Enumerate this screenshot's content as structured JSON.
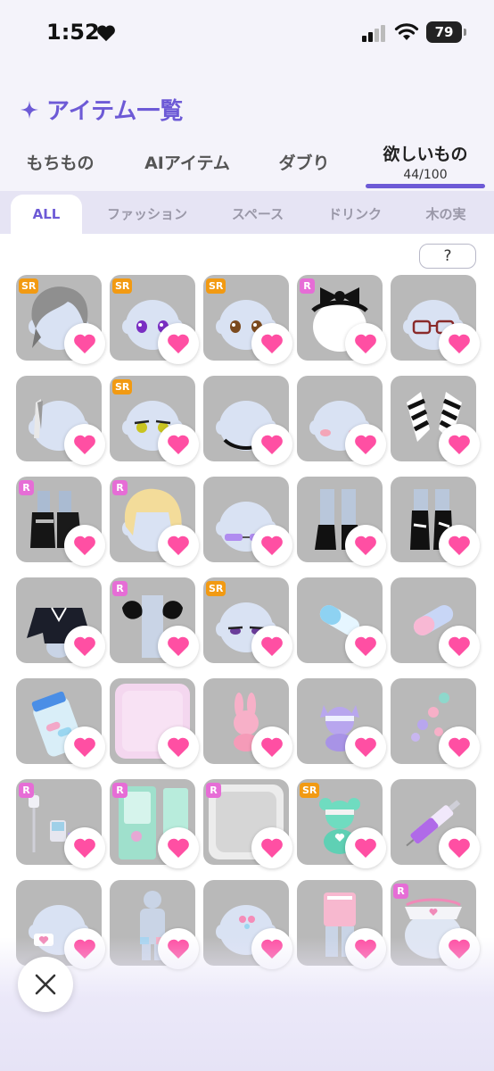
{
  "status": {
    "time": "1:52",
    "battery": "79"
  },
  "header": {
    "title": "アイテム一覧"
  },
  "main_tabs": [
    {
      "label": "もちもの"
    },
    {
      "label": "AIアイテム"
    },
    {
      "label": "ダブり"
    },
    {
      "label": "欲しいもの",
      "count": "44/100",
      "active": true
    }
  ],
  "sub_tabs": [
    {
      "label": "ALL",
      "active": true
    },
    {
      "label": "ファッション"
    },
    {
      "label": "スペース"
    },
    {
      "label": "ドリンク"
    },
    {
      "label": "木の実"
    }
  ],
  "help_label": "?",
  "colors": {
    "accent": "#6d5ad6",
    "heart": "#ff4fa3",
    "sr_badge": "#f29a12",
    "r_badge": "#e66dd6"
  },
  "items": [
    {
      "badge": "SR",
      "art": "hair-silver"
    },
    {
      "badge": "SR",
      "art": "eyes-purple"
    },
    {
      "badge": "SR",
      "art": "eyes-brown"
    },
    {
      "badge": "R",
      "art": "black-ribbon"
    },
    {
      "badge": "",
      "art": "glasses"
    },
    {
      "badge": "",
      "art": "hair-clip"
    },
    {
      "badge": "SR",
      "art": "eyes-green"
    },
    {
      "badge": "",
      "art": "choker"
    },
    {
      "badge": "",
      "art": "blush"
    },
    {
      "badge": "",
      "art": "striped-sleeves"
    },
    {
      "badge": "R",
      "art": "black-boots"
    },
    {
      "badge": "R",
      "art": "blonde-hair"
    },
    {
      "badge": "",
      "art": "sunglasses"
    },
    {
      "badge": "",
      "art": "black-leg-socks"
    },
    {
      "badge": "",
      "art": "ripped-socks"
    },
    {
      "badge": "",
      "art": "black-jacket"
    },
    {
      "badge": "R",
      "art": "puff-sleeves"
    },
    {
      "badge": "SR",
      "art": "eyes-lashes"
    },
    {
      "badge": "",
      "art": "pill-blue"
    },
    {
      "badge": "",
      "art": "pill-pink"
    },
    {
      "badge": "",
      "art": "pill-jar"
    },
    {
      "badge": "",
      "art": "pink-floor"
    },
    {
      "badge": "",
      "art": "bunny-plush"
    },
    {
      "badge": "",
      "art": "cat-plush"
    },
    {
      "badge": "",
      "art": "mini-plushes"
    },
    {
      "badge": "R",
      "art": "iv-stand"
    },
    {
      "badge": "R",
      "art": "mint-door"
    },
    {
      "badge": "R",
      "art": "grey-tile"
    },
    {
      "badge": "SR",
      "art": "bear-plush"
    },
    {
      "badge": "",
      "art": "syringe"
    },
    {
      "badge": "",
      "art": "heart-patch"
    },
    {
      "badge": "",
      "art": "pajama-body"
    },
    {
      "badge": "",
      "art": "hair-pins"
    },
    {
      "badge": "",
      "art": "nurse-outfit"
    },
    {
      "badge": "R",
      "art": "nurse-cap"
    }
  ]
}
